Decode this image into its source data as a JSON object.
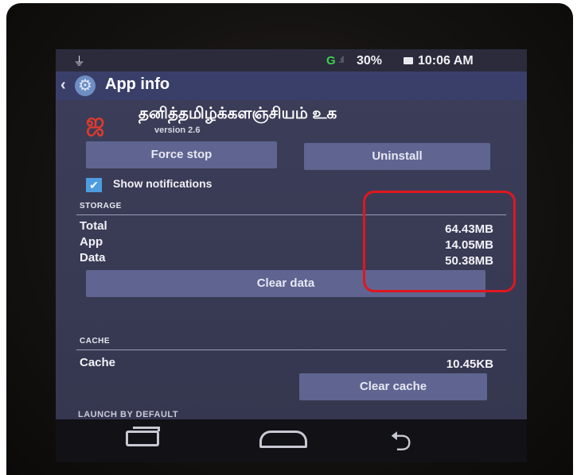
{
  "status_bar": {
    "usb_icon": "usb-icon",
    "network_label": "G",
    "signal_icon": "signal-bars-icon",
    "battery_percent": "30%",
    "battery_icon": "battery-icon",
    "time": "10:06 AM"
  },
  "action_bar": {
    "back_icon": "chevron-left-icon",
    "app_icon": "settings-icon",
    "title": "App info"
  },
  "app": {
    "name": "தனித்தமிழ்க்களஞ்சியம் உக",
    "version": "version 2.6",
    "icon": "app-logo-icon"
  },
  "buttons": {
    "force_stop": "Force stop",
    "uninstall": "Uninstall"
  },
  "notifications": {
    "checked": true,
    "label": "Show notifications"
  },
  "storage": {
    "header": "STORAGE",
    "rows": [
      {
        "label": "Total",
        "value": "64.43MB"
      },
      {
        "label": "App",
        "value": "14.05MB"
      },
      {
        "label": "Data",
        "value": "50.38MB"
      }
    ],
    "clear_data": "Clear data"
  },
  "cache": {
    "header": "CACHE",
    "label": "Cache",
    "value": "10.45KB",
    "clear_cache": "Clear cache"
  },
  "launch_header_partial": "LAUNCH BY DEFAULT",
  "nav_bar": {
    "recents_icon": "recents-icon",
    "home_icon": "home-icon",
    "back_icon": "back-arrow-icon"
  },
  "highlight_color": "#e0161f"
}
